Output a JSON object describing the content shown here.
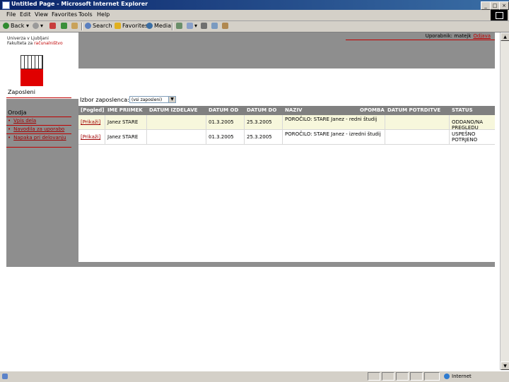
{
  "window": {
    "title": "Untitled Page - Microsoft Internet Explorer",
    "buttons": [
      "_",
      "□",
      "×"
    ]
  },
  "menu": [
    "File",
    "Edit",
    "View",
    "Favorites",
    "Tools",
    "Help"
  ],
  "toolbar": {
    "back": "Back",
    "search": "Search",
    "favorites": "Favorites",
    "media": "Media"
  },
  "sidebar": {
    "logo_line1": "Univerza v Ljubljani",
    "logo_line2": "Fakulteta za ",
    "logo_line2_red": "računalništvo",
    "section1": "Zaposleni",
    "section2": "Orodja",
    "items": [
      "Vpis dela",
      "Navodila za uporabo",
      "Napaka pri delovanju"
    ]
  },
  "header": {
    "user_label": "Uporabnik: matejk",
    "logout": "Odjava"
  },
  "filter": {
    "label": "Izbor zaposlenca:",
    "selected": "(vsi zaposleni)"
  },
  "table": {
    "columns": [
      "[Pogled]",
      "IME PRIIMEK",
      "DATUM IZDELAVE",
      "DATUM OD",
      "DATUM DO",
      "NAZIV",
      "OPOMBA",
      "DATUM POTRDITVE",
      "STATUS"
    ],
    "rows": [
      {
        "link": "[Prikaži]",
        "name": "Janez STARE",
        "created": "",
        "from": "01.3.2005",
        "to": "25.3.2005",
        "title": "POROČILO: STARE Janez - redni študij",
        "note": "",
        "confirmed": "",
        "status": "ODDANO/NA PREGLEDU"
      },
      {
        "link": "[Prikaži]",
        "name": "Janez STARE",
        "created": "",
        "from": "01.3.2005",
        "to": "25.3.2005",
        "title": "POROČILO: STARE Janez - izredni študij",
        "note": "",
        "confirmed": "",
        "status": "USPEŠNO POTRJENO"
      }
    ]
  },
  "status": {
    "zone": "Internet"
  },
  "colors": {
    "panel_gray": "#8e8e8e",
    "accent_red": "#c00000",
    "header_gray": "#808080",
    "row_yellow": "#f7f7dc"
  }
}
